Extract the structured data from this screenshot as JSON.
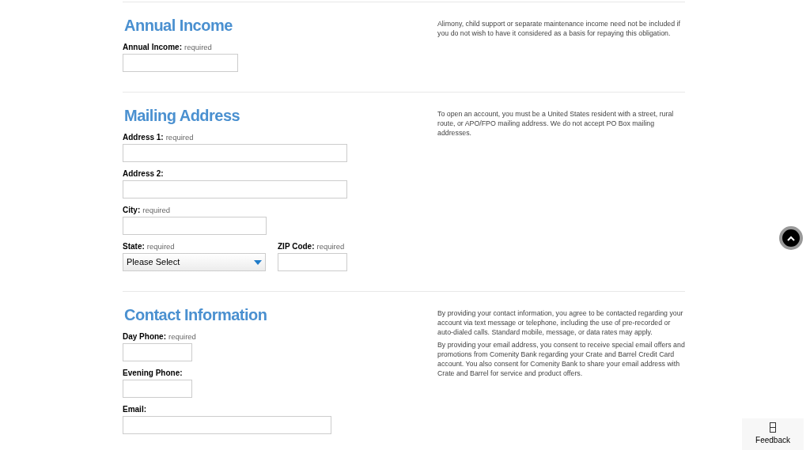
{
  "sections": [
    {
      "heading": "Annual Income",
      "notes": [
        "Alimony, child support or separate maintenance income need not be included if you do not wish to have it considered as a basis for repaying this obligation."
      ],
      "rows": [
        [
          {
            "kind": "text",
            "label": "Annual Income:",
            "required": "required"
          }
        ]
      ]
    },
    {
      "heading": "Mailing Address",
      "notes": [
        "To open an account, you must be a United States resident with a street, rural route, or APO/FPO mailing address. We do not accept PO Box mailing addresses."
      ],
      "rows": [
        [
          {
            "kind": "text",
            "label": "Address 1:",
            "required": "required"
          }
        ],
        [
          {
            "kind": "text",
            "label": "Address 2:"
          }
        ],
        [
          {
            "kind": "text",
            "label": "City:",
            "required": "required"
          }
        ],
        [
          {
            "kind": "select",
            "label": "State:",
            "required": "required",
            "value": "Please Select"
          },
          {
            "kind": "text",
            "label": "ZIP Code:",
            "required": "required"
          }
        ]
      ]
    },
    {
      "heading": "Contact Information",
      "notes": [
        "By providing your contact information, you agree to be contacted regarding your account via text message or telephone, including the use of pre-recorded or auto-dialed calls. Standard mobile, message, or data rates may apply.",
        "By providing your email address, you consent to receive special email offers and promotions from Comenity Bank regarding your Crate and Barrel Credit Card account. You also consent for Comenity Bank to share your email address with Crate and Barrel for service and product offers."
      ],
      "rows": [
        [
          {
            "kind": "text",
            "label": "Day Phone:",
            "required": "required"
          }
        ],
        [
          {
            "kind": "text",
            "label": "Evening Phone:"
          }
        ],
        [
          {
            "kind": "text",
            "label": "Email:"
          }
        ]
      ]
    }
  ],
  "feedback": {
    "label": "Feedback"
  }
}
